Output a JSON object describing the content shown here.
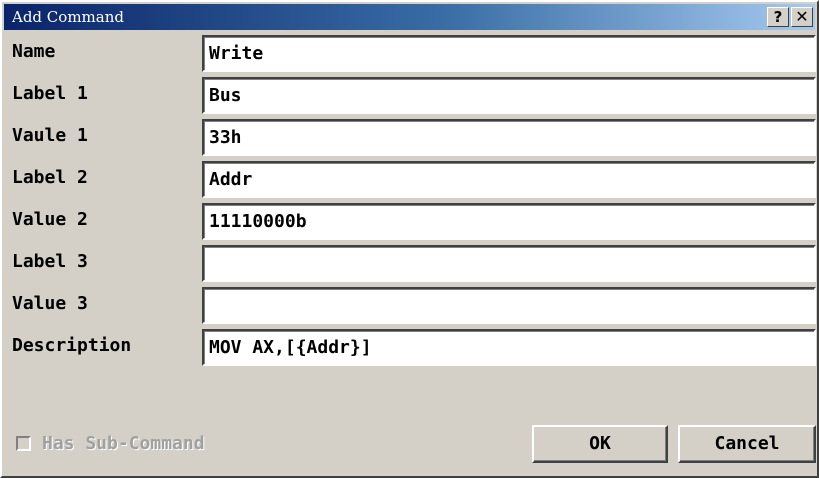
{
  "window": {
    "title": "Add Command",
    "help_glyph": "?",
    "close_glyph": "✕"
  },
  "fields": [
    {
      "label": "Name",
      "value": "Write"
    },
    {
      "label": "Label 1",
      "value": "Bus"
    },
    {
      "label": "Vaule 1",
      "value": "33h"
    },
    {
      "label": "Label 2",
      "value": "Addr"
    },
    {
      "label": "Value 2",
      "value": "11110000b"
    },
    {
      "label": "Label 3",
      "value": ""
    },
    {
      "label": "Value 3",
      "value": ""
    },
    {
      "label": "Description",
      "value": "MOV AX,[{Addr}]"
    }
  ],
  "sub_command": {
    "label": "Has Sub-Command",
    "checked": false,
    "enabled": false
  },
  "buttons": {
    "ok": "OK",
    "cancel": "Cancel"
  },
  "colors": {
    "title_bar_start": "#0a246a",
    "title_bar_end": "#a6caf0",
    "dialog_face": "#d4d0c8",
    "disabled_text": "#a0a0a0"
  },
  "icons": {
    "help": "help-icon",
    "close": "close-icon"
  }
}
